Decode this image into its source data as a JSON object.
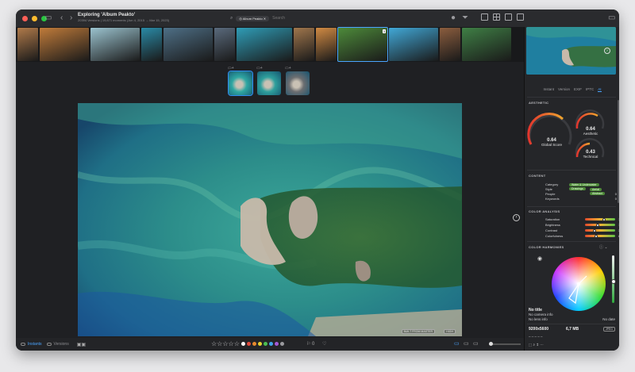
{
  "window": {
    "title": "Exploring 'Album Peakto'",
    "subtitle": "20394 Versions | 19,871 moments (Jun 4, 2015 → Mar 15, 2023)"
  },
  "search": {
    "chip_label": "Album Peakto",
    "placeholder": "Search"
  },
  "filmstrip": {
    "selected_index": 9,
    "selected_badge": "3",
    "thumbs": [
      {
        "icon": "photo-thumbnail-icon",
        "color": "#b07a4a"
      },
      {
        "icon": "photo-thumbnail-icon",
        "color": "#c07b3a"
      },
      {
        "icon": "photo-thumbnail-icon",
        "color": "#9bc3cf"
      },
      {
        "icon": "photo-thumbnail-icon",
        "color": "#2a8aa6"
      },
      {
        "icon": "photo-thumbnail-icon",
        "color": "#4e6f86"
      },
      {
        "icon": "photo-thumbnail-icon",
        "color": "#5a6a7c"
      },
      {
        "icon": "photo-thumbnail-icon",
        "color": "#2f9cb6"
      },
      {
        "icon": "photo-thumbnail-icon",
        "color": "#a0764c"
      },
      {
        "icon": "photo-thumbnail-icon",
        "color": "#d18a43"
      },
      {
        "icon": "photo-thumbnail-icon",
        "color": "#4d8a3a"
      },
      {
        "icon": "photo-thumbnail-icon",
        "color": "#41a8d7"
      },
      {
        "icon": "photo-thumbnail-icon",
        "color": "#8b5d3e"
      },
      {
        "icon": "photo-thumbnail-icon",
        "color": "#3f7f45"
      }
    ]
  },
  "variants": {
    "items": [
      {
        "color": "#2fa7a2",
        "selected": true
      },
      {
        "color": "#2e9f9c",
        "selected": false
      },
      {
        "color": "#6b6d70",
        "selected": false
      }
    ]
  },
  "viewer": {
    "built_badge": "BUILT FROM MASTER",
    "hi_badge": "HIGH"
  },
  "bottombar": {
    "tab_instants": "Instants",
    "tab_versions": "Versions",
    "stars": "☆☆☆☆☆",
    "flag_count": "0",
    "color_labels": [
      "#ffffff",
      "#e04a3c",
      "#e68a2e",
      "#e6d02e",
      "#4cbf52",
      "#3ea4e8",
      "#a45ad6",
      "#9a9a9e"
    ]
  },
  "panel": {
    "tabs": [
      "Instant",
      "Version",
      "EXIF",
      "IPTC",
      "AI"
    ],
    "active_tab": "AI",
    "aesthetic_title": "AESTHETIC",
    "global_score": "0.64",
    "global_label": "Global Score",
    "aesthetic_score": "0.64",
    "aesthetic_label": "Aesthetic",
    "technical_score": "0.43",
    "technical_label": "Technical",
    "content_title": "CONTENT",
    "category_label": "Category",
    "category_tags": [
      "Water & Underwater",
      "Drawings"
    ],
    "style_label": "Style",
    "style_tags": [
      "Aerial",
      "Abstract"
    ],
    "people_label": "People",
    "people_value": "0",
    "keywords_label": "Keywords",
    "keywords_value": "0",
    "color_analysis_title": "COLOR ANALYSIS",
    "color_analysis": [
      {
        "label": "Saturation",
        "value": "171",
        "level": 0.66
      },
      {
        "label": "Brightness",
        "value": "109",
        "level": 0.42
      },
      {
        "label": "Contrast",
        "value": "31",
        "level": 0.28
      },
      {
        "label": "Colorfulness",
        "value": "84",
        "level": 0.34
      }
    ],
    "harmonies_title": "COLOR HARMONIES",
    "meta_title": "No title",
    "meta_camera": "No camera info",
    "meta_lens": "No lens info",
    "meta_date": "No date",
    "meta_dimensions": "9200x5600",
    "meta_size": "6,7 MB",
    "meta_format": "JPEG"
  }
}
